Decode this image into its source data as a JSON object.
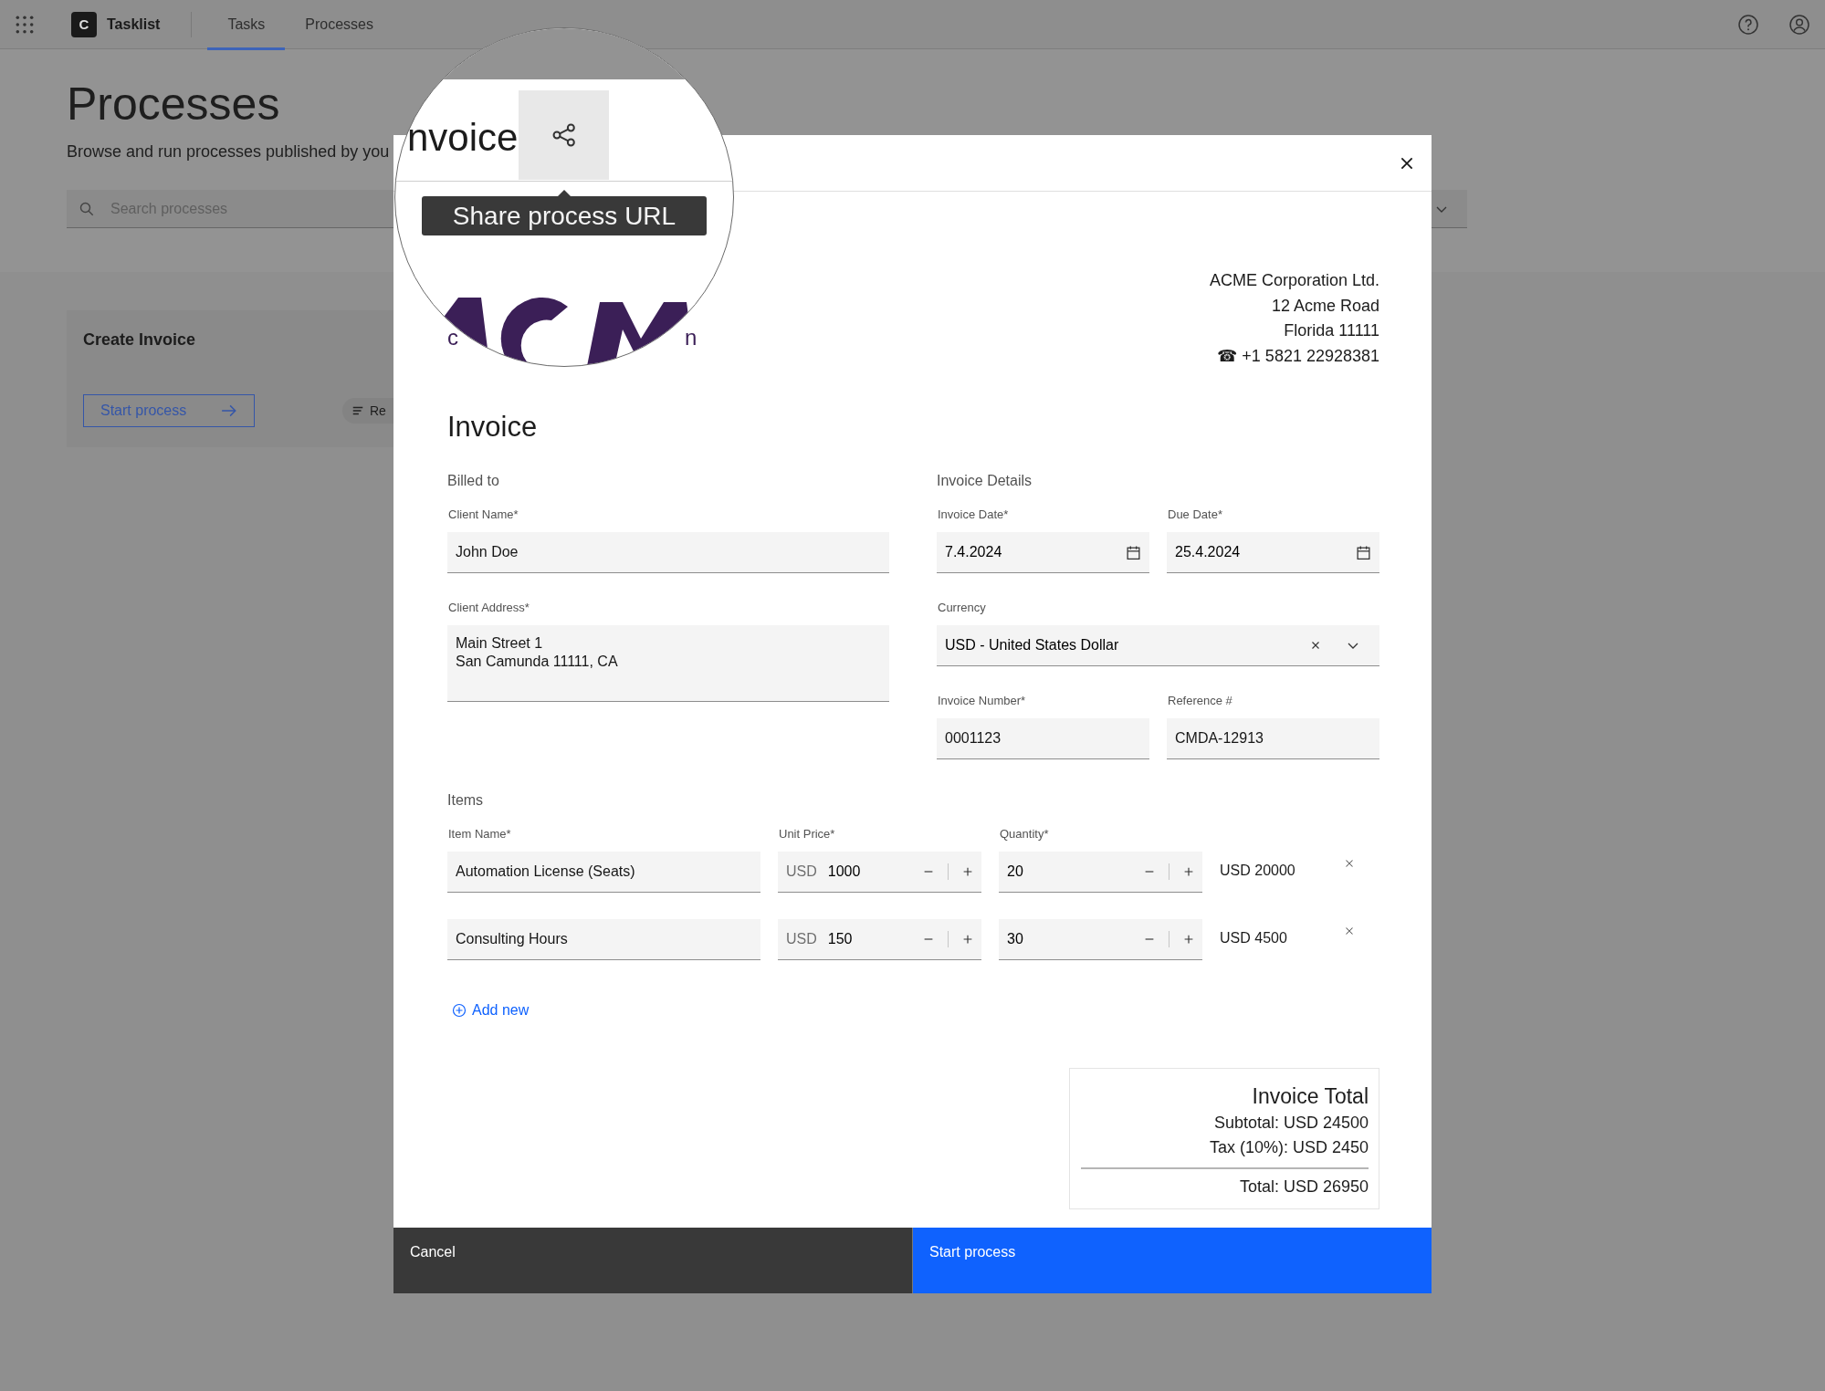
{
  "header": {
    "logo_letter": "C",
    "app_name": "Tasklist",
    "tabs": [
      {
        "label": "Tasks",
        "selected": true
      },
      {
        "label": "Processes",
        "selected": false
      }
    ]
  },
  "page": {
    "title": "Processes",
    "subtitle": "Browse and run processes published by you",
    "search": {
      "placeholder": "Search processes"
    },
    "process_card": {
      "title": "Create Invoice",
      "button": "Start process",
      "tag": "Re"
    }
  },
  "dialog": {
    "title": "nvoice",
    "tooltip": "Share process URL",
    "logo_fragments": [
      "c",
      "n"
    ],
    "company_lines": [
      "ACME Corporation Ltd.",
      "12 Acme Road",
      "Florida 11111",
      "☎ +1 5821 22928381"
    ],
    "heading": "Invoice",
    "billed_to": {
      "title": "Billed to",
      "client_name": {
        "label": "Client Name*",
        "value": "John Doe"
      },
      "client_address": {
        "label": "Client Address*",
        "lines": [
          "Main Street 1",
          "San Camunda 11111, CA"
        ]
      }
    },
    "details": {
      "title": "Invoice Details",
      "invoice_date": {
        "label": "Invoice Date*",
        "value": "7.4.2024"
      },
      "due_date": {
        "label": "Due Date*",
        "value": "25.4.2024"
      },
      "currency": {
        "label": "Currency",
        "value": "USD - United States Dollar"
      },
      "invoice_number": {
        "label": "Invoice Number*",
        "value": "0001123"
      },
      "reference": {
        "label": "Reference #",
        "value": "CMDA-12913"
      }
    },
    "items": {
      "title": "Items",
      "columns": [
        "Item Name*",
        "Unit Price*",
        "Quantity*"
      ],
      "rows": [
        {
          "name": "Automation License (Seats)",
          "currency": "USD",
          "unit_price": "1000",
          "quantity": "20",
          "total": "USD 20000"
        },
        {
          "name": "Consulting Hours",
          "currency": "USD",
          "unit_price": "150",
          "quantity": "30",
          "total": "USD 4500"
        }
      ],
      "add_button": "Add new"
    },
    "totals": {
      "title": "Invoice Total",
      "subtotal": "Subtotal: USD 24500",
      "tax": "Tax (10%): USD 2450",
      "total": "Total: USD 26950"
    },
    "footer": {
      "cancel": "Cancel",
      "submit": "Start process"
    }
  }
}
